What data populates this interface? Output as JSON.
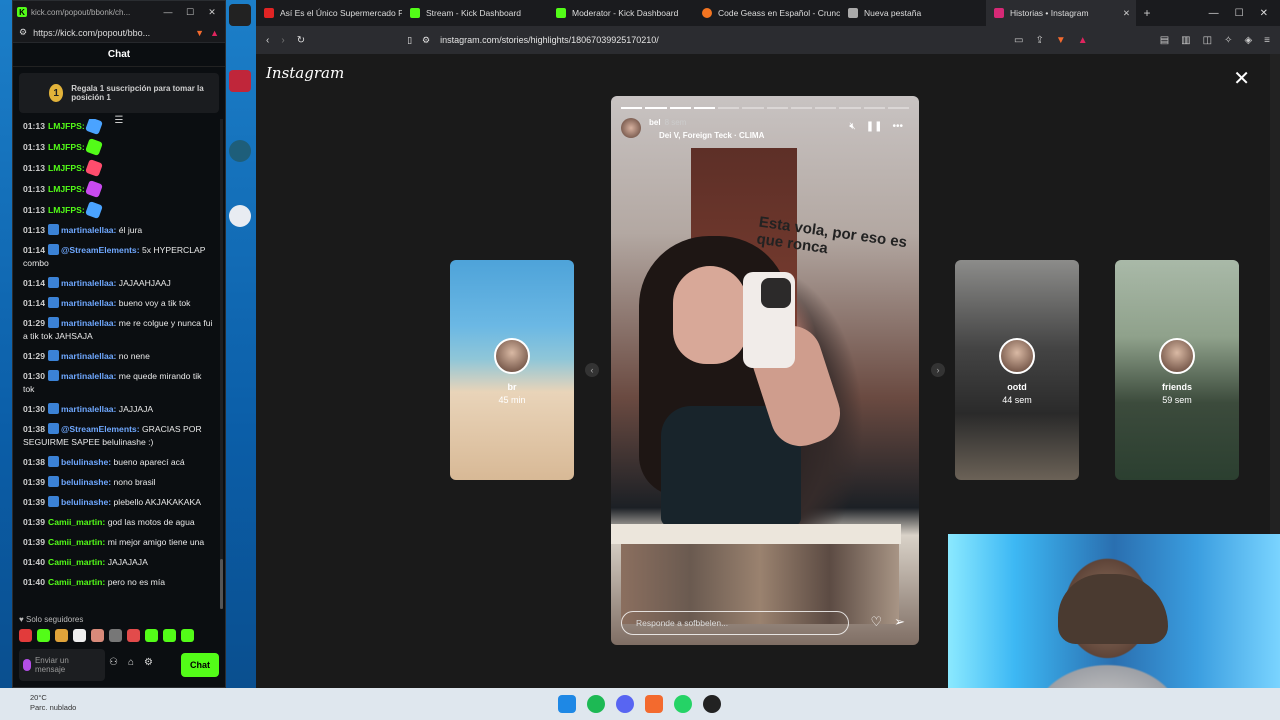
{
  "chat_window": {
    "tab_title": "kick.com/popout/bbonk/ch...",
    "url": "https://kick.com/popout/bbo...",
    "header": "Chat",
    "promo_rank": "1",
    "promo_text": "Regala 1 suscripción para tomar la posición 1",
    "messages": [
      {
        "time": "01:13",
        "user": "LMJFPS:",
        "text": "",
        "color": "green"
      },
      {
        "time": "01:13",
        "user": "LMJFPS:",
        "text": "",
        "color": "green"
      },
      {
        "time": "01:13",
        "user": "LMJFPS:",
        "text": "",
        "color": "green"
      },
      {
        "time": "01:13",
        "user": "LMJFPS:",
        "text": "",
        "color": "green"
      },
      {
        "time": "01:13",
        "user": "LMJFPS:",
        "text": "",
        "color": "green"
      },
      {
        "time": "01:13",
        "user": "martinalellaa:",
        "text": "él jura",
        "color": "blue"
      },
      {
        "time": "01:14",
        "user": "@StreamElements:",
        "text": "5x HYPERCLAP combo",
        "color": "blue"
      },
      {
        "time": "01:14",
        "user": "martinalellaa:",
        "text": "JAJAAHJAAJ",
        "color": "blue"
      },
      {
        "time": "01:14",
        "user": "martinalellaa:",
        "text": "bueno voy a tik tok",
        "color": "blue"
      },
      {
        "time": "01:29",
        "user": "martinalellaa:",
        "text": "me re colgue y nunca fui a tik tok JAHSAJA",
        "color": "blue"
      },
      {
        "time": "01:29",
        "user": "martinalellaa:",
        "text": "no nene",
        "color": "blue"
      },
      {
        "time": "01:30",
        "user": "martinalellaa:",
        "text": "me quede mirando tik tok",
        "color": "blue"
      },
      {
        "time": "01:30",
        "user": "martinalellaa:",
        "text": "JAJJAJA",
        "color": "blue"
      },
      {
        "time": "01:38",
        "user": "@StreamElements:",
        "text": "GRACIAS POR SEGUIRME SAPEE belulinashe :)",
        "color": "blue"
      },
      {
        "time": "01:38",
        "user": "belulinashe:",
        "text": "bueno aparecí acá",
        "color": "blue"
      },
      {
        "time": "01:39",
        "user": "belulinashe:",
        "text": "nono brasil",
        "color": "blue"
      },
      {
        "time": "01:39",
        "user": "belulinashe:",
        "text": "plebello AKJAKAKAKA",
        "color": "blue"
      },
      {
        "time": "01:39",
        "user": "Camii_martin:",
        "text": "god las motos de agua",
        "color": "green"
      },
      {
        "time": "01:39",
        "user": "Camii_martin:",
        "text": "mi mejor amigo tiene una",
        "color": "green"
      },
      {
        "time": "01:40",
        "user": "Camii_martin:",
        "text": "JAJAJAJA",
        "color": "green"
      },
      {
        "time": "01:40",
        "user": "Camii_martin:",
        "text": "pero no es mía",
        "color": "green"
      }
    ],
    "followers_only": "Solo seguidores",
    "input_placeholder": "Enviar un mensaje",
    "send_label": "Chat"
  },
  "browser": {
    "tabs": [
      {
        "label": "Así Es el Único Supermercado P",
        "color": "#e02424"
      },
      {
        "label": "Stream - Kick Dashboard",
        "color": "#53fc18"
      },
      {
        "label": "Moderator - Kick Dashboard",
        "color": "#53fc18"
      },
      {
        "label": "Code Geass en Español - Crunc",
        "color": "#f47521"
      },
      {
        "label": "Nueva pestaña",
        "color": "#aaaaaa"
      },
      {
        "label": "Historias • Instagram",
        "color": "#d62976",
        "active": true
      }
    ],
    "url": "instagram.com/stories/highlights/18067039925170210/"
  },
  "instagram": {
    "logo": "Instagram",
    "story": {
      "username": "bel",
      "time": "8 sem",
      "song": "Dei V, Foreign Teck · CLIMA",
      "caption": "Esta vola, por eso es que ronca",
      "reply_placeholder": "Responde a sofbbelen..."
    },
    "previews": [
      {
        "name": "br",
        "time": "45 min"
      },
      {
        "name": "ootd",
        "time": "44 sem"
      },
      {
        "name": "friends",
        "time": "59 sem"
      }
    ]
  },
  "taskbar": {
    "temperature": "20°C",
    "condition": "Parc. nublado"
  }
}
